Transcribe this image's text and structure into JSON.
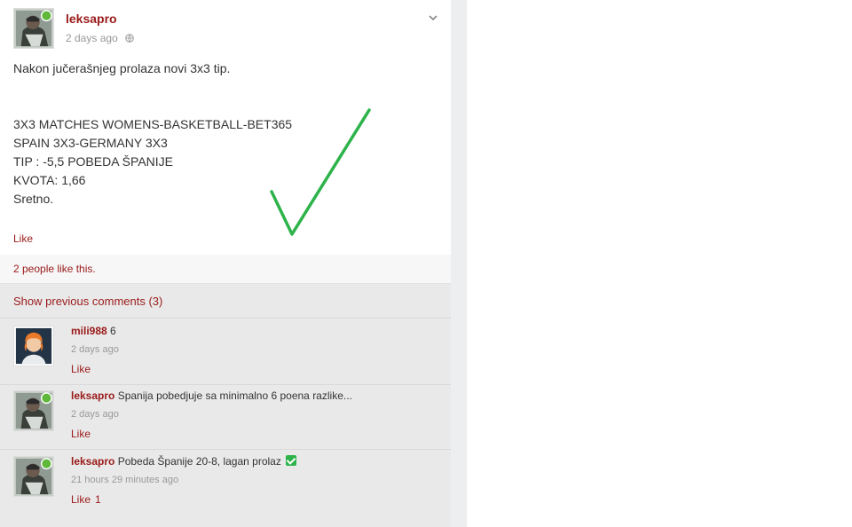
{
  "post": {
    "author": "leksapro",
    "time": "2 days ago",
    "lines": [
      "Nakon jučerašnjeg prolaza novi 3x3 tip.",
      "",
      "",
      "3X3 MATCHES WOMENS-BASKETBALL-BET365",
      "SPAIN 3X3-GERMANY 3X3",
      "TIP : -5,5 POBEDA ŠPANIJE",
      "KVOTA: 1,66",
      "Sretno."
    ],
    "like_label": "Like",
    "likes_text": "2 people like this.",
    "annotation_icon": "checkmark",
    "annotation_color": "#2db34a"
  },
  "comments_section": {
    "show_previous": "Show previous comments (3)",
    "items": [
      {
        "author": "mili988",
        "text": "6",
        "time": "2 days ago",
        "like_label": "Like",
        "like_count": ""
      },
      {
        "author": "leksapro",
        "text": "Spanija pobedjuje sa minimalno 6 poena razlike...",
        "time": "2 days ago",
        "like_label": "Like",
        "like_count": ""
      },
      {
        "author": "leksapro",
        "text": "Pobeda Španije 20-8, lagan prolaz",
        "time": "21 hours 29 minutes ago",
        "like_label": "Like",
        "like_count": "1"
      }
    ]
  },
  "colors": {
    "link": "#9a1a1a",
    "online": "#5fb83a",
    "checkmark": "#2db34a"
  }
}
